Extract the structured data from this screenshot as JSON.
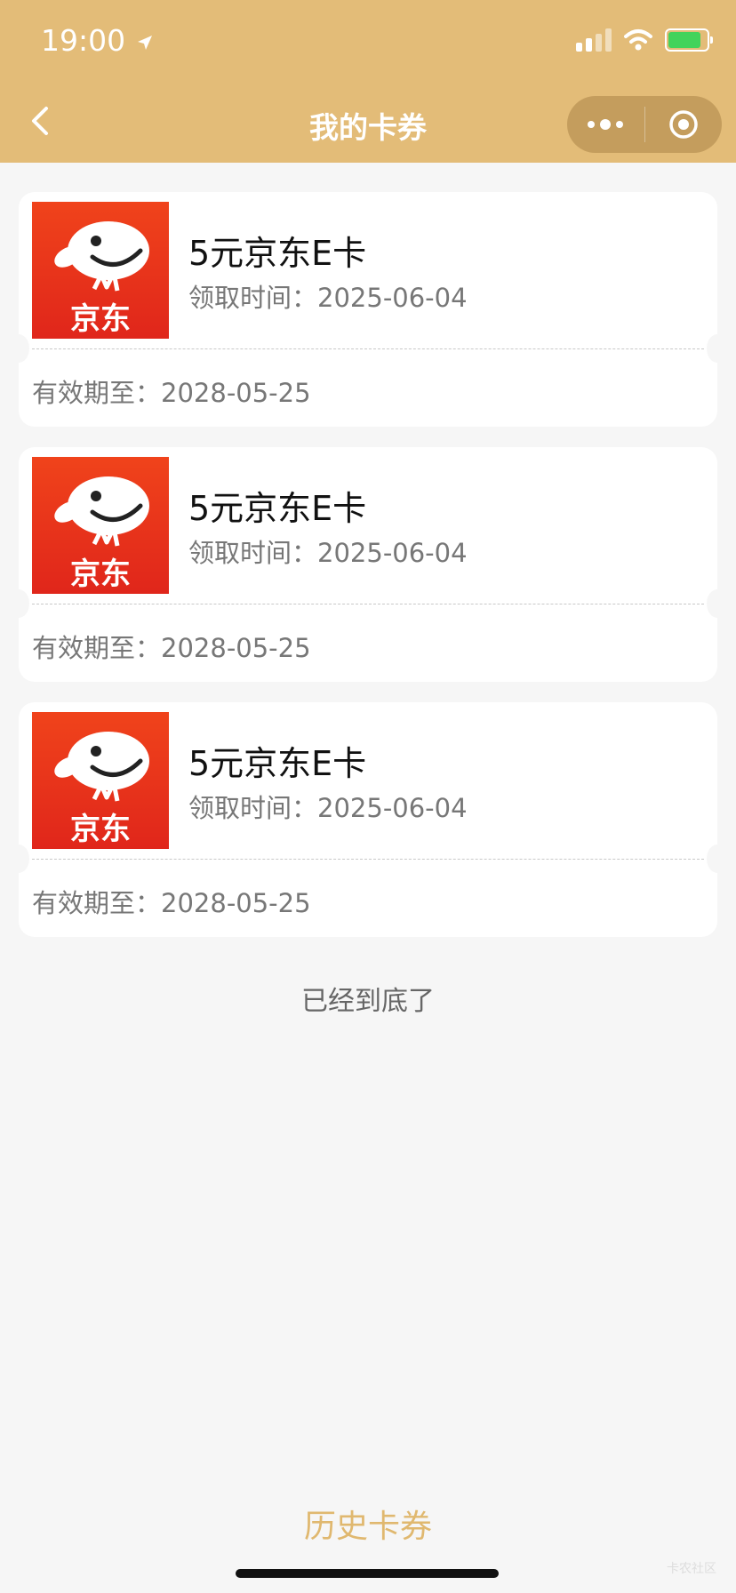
{
  "status_bar": {
    "time": "19:00"
  },
  "header": {
    "title": "我的卡券"
  },
  "cards": [
    {
      "logo_text": "京东",
      "name": "5元京东E卡",
      "received_label": "领取时间：",
      "received_date": "2025-06-04",
      "expire_label": "有效期至：",
      "expire_date": "2028-05-25"
    },
    {
      "logo_text": "京东",
      "name": "5元京东E卡",
      "received_label": "领取时间：",
      "received_date": "2025-06-04",
      "expire_label": "有效期至：",
      "expire_date": "2028-05-25"
    },
    {
      "logo_text": "京东",
      "name": "5元京东E卡",
      "received_label": "领取时间：",
      "received_date": "2025-06-04",
      "expire_label": "有效期至：",
      "expire_date": "2028-05-25"
    }
  ],
  "list_end_text": "已经到底了",
  "footer": {
    "history_button": "历史卡券"
  },
  "watermark": "卡农社区",
  "colors": {
    "header_bg": "#e3bc78",
    "accent": "#e0b86f",
    "jd_red": "#e83a1c"
  },
  "icons": [
    "back-arrow-icon",
    "location-arrow-icon",
    "wifi-icon",
    "battery-charging-icon",
    "more-dots-icon",
    "close-target-icon",
    "jd-logo-icon"
  ]
}
